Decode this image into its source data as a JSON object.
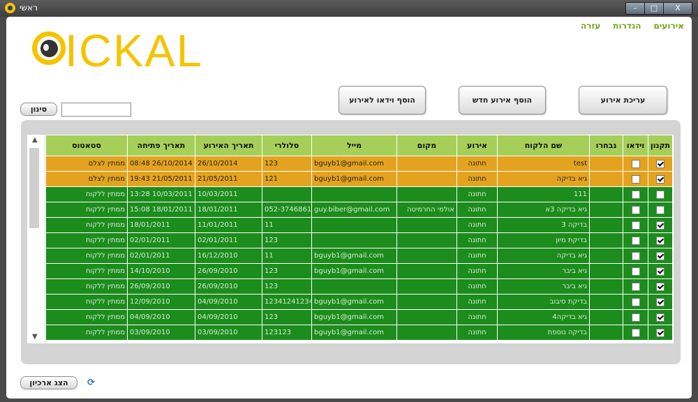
{
  "window": {
    "title": "ראשי",
    "controls": {
      "minimize": "–",
      "maximize": "□",
      "close": "X"
    }
  },
  "menu": [
    "אירועים",
    "הגדרות",
    "עזרה"
  ],
  "logo": {
    "text": "ICKAL"
  },
  "toolbar": {
    "edit_event": "עריכת אירוע",
    "add_event": "הוסף אירוע חדש",
    "add_video": "הוסף וידאו לאירוע"
  },
  "filter": {
    "button": "סינון",
    "value": ""
  },
  "grid": {
    "headers": [
      "תקנון",
      "וידאו",
      "נבחרו",
      "שם הלקוח",
      "אירוע",
      "מקום",
      "מייל",
      "סלולרי",
      "תאריך האירוע",
      "תאריך פתיחה",
      "סטאטוס"
    ],
    "rows": [
      {
        "style": "orange",
        "terms": true,
        "video": false,
        "selected": "",
        "customer": "test",
        "event": "חתונה",
        "place": "",
        "email": "bguyb1@gmail.com",
        "mobile": "123",
        "event_date": "26/10/2014",
        "opened": "08:48 26/10/2014",
        "status": "ממתין לצלם"
      },
      {
        "style": "orange",
        "terms": true,
        "video": false,
        "selected": "",
        "customer": "גיא בדיקה",
        "event": "חתונה",
        "place": "",
        "email": "bguyb1@gmail.com",
        "mobile": "121",
        "event_date": "21/05/2011",
        "opened": "19:43 21/05/2011",
        "status": "ממתין לצלם"
      },
      {
        "style": "green",
        "terms": false,
        "video": false,
        "selected": "",
        "customer": "111",
        "event": "חתונה",
        "place": "",
        "email": "",
        "mobile": "",
        "event_date": "10/03/2011",
        "opened": "13:28 10/03/2011",
        "status": "ממתין ללקוח"
      },
      {
        "style": "green",
        "terms": false,
        "video": false,
        "selected": "",
        "customer": "גיא בדיקה 3א",
        "event": "חתונה",
        "place": "אולמי החרמיטה",
        "email": "guy.biber@gmail.com",
        "mobile": "052-3746861",
        "event_date": "18/01/2011",
        "opened": "15:08 18/01/2011",
        "status": "ממתין ללקוח"
      },
      {
        "style": "green",
        "terms": true,
        "video": false,
        "selected": "",
        "customer": "בדיקה 3",
        "event": "חתונה",
        "place": "",
        "email": "",
        "mobile": "11",
        "event_date": "11/01/2011",
        "opened": "18/01/2011",
        "status": "ממתין ללקוח"
      },
      {
        "style": "green",
        "terms": true,
        "video": false,
        "selected": "",
        "customer": "בדיקת מיון",
        "event": "חתונה",
        "place": "",
        "email": "",
        "mobile": "123",
        "event_date": "02/01/2011",
        "opened": "02/01/2011",
        "status": "ממתין ללקוח"
      },
      {
        "style": "green",
        "terms": true,
        "video": false,
        "selected": "",
        "customer": "גיא בדיקה",
        "event": "חתונה",
        "place": "",
        "email": "bguyb1@gmail.com",
        "mobile": "11",
        "event_date": "16/12/2010",
        "opened": "02/01/2011",
        "status": "ממתין ללקוח"
      },
      {
        "style": "green",
        "terms": true,
        "video": false,
        "selected": "",
        "customer": "גיא ביבר",
        "event": "חתונה",
        "place": "",
        "email": "bguyb1@gmail.com",
        "mobile": "123",
        "event_date": "26/09/2010",
        "opened": "14/10/2010",
        "status": "ממתין ללקוח"
      },
      {
        "style": "green",
        "terms": true,
        "video": false,
        "selected": "",
        "customer": "גיא ביבר",
        "event": "חתונה",
        "place": "",
        "email": "",
        "mobile": "123",
        "event_date": "26/09/2010",
        "opened": "26/09/2010",
        "status": "ממתין ללקוח"
      },
      {
        "style": "green",
        "terms": true,
        "video": false,
        "selected": "",
        "customer": "בדיקת סיבוב",
        "event": "חתונה",
        "place": "",
        "email": "bguyb1@gmail.com",
        "mobile": "12341241234",
        "event_date": "04/09/2010",
        "opened": "12/09/2010",
        "status": "ממתין ללקוח"
      },
      {
        "style": "green",
        "terms": true,
        "video": false,
        "selected": "",
        "customer": "גיא בדיקה4",
        "event": "חתונה",
        "place": "",
        "email": "bguyb1@gmail.com",
        "mobile": "123",
        "event_date": "04/09/2010",
        "opened": "04/09/2010",
        "status": "ממתין ללקוח"
      },
      {
        "style": "green",
        "terms": true,
        "video": false,
        "selected": "",
        "customer": "בדיקה נוספת",
        "event": "חתונה",
        "place": "",
        "email": "bguyb1@gmail.com",
        "mobile": "123123",
        "event_date": "03/09/2010",
        "opened": "03/09/2010",
        "status": "ממתין ללקוח"
      }
    ]
  },
  "footer": {
    "archive_button": "הצג ארכיון",
    "refresh_icon": "refresh-icon"
  },
  "colors": {
    "menu": "#79a21c",
    "logo": "#f4c400",
    "header": "#a6cf59",
    "row_orange": "#e4a31f",
    "row_green": "#1c8c1c"
  }
}
